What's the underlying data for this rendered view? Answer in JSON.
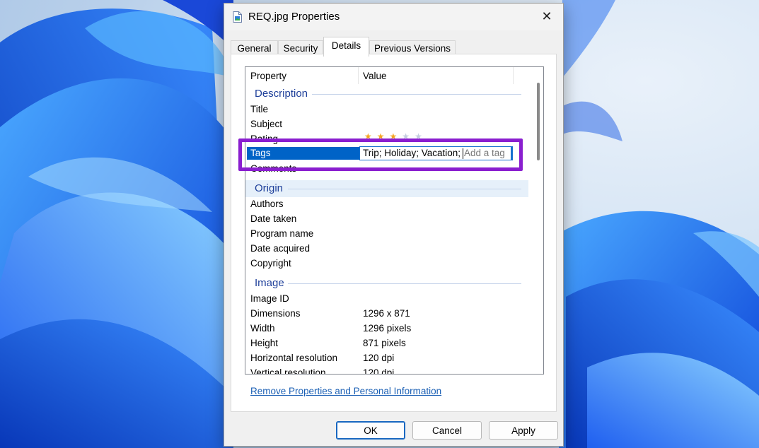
{
  "window": {
    "title": "REQ.jpg Properties",
    "close_glyph": "✕"
  },
  "tabs": [
    {
      "label": "General",
      "active": false
    },
    {
      "label": "Security",
      "active": false
    },
    {
      "label": "Details",
      "active": true
    },
    {
      "label": "Previous Versions",
      "active": false
    }
  ],
  "columns": {
    "property": "Property",
    "value": "Value"
  },
  "groups": {
    "description": "Description",
    "origin": "Origin",
    "image": "Image"
  },
  "description_rows": {
    "title": "Title",
    "subject": "Subject",
    "rating": "Rating",
    "tags": "Tags",
    "comments": "Comments"
  },
  "rating": {
    "stars_filled": 3,
    "stars_total": 5,
    "filled_color": "#f5a623",
    "empty_color": "#c5cce0"
  },
  "tags_value": "Trip; Holiday; Vacation;",
  "tags_placeholder": "Add a tag",
  "origin_rows": {
    "authors": "Authors",
    "date_taken": "Date taken",
    "program_name": "Program name",
    "date_acquired": "Date acquired",
    "copyright": "Copyright"
  },
  "image_rows": {
    "image_id": {
      "label": "Image ID",
      "value": ""
    },
    "dimensions": {
      "label": "Dimensions",
      "value": "1296 x 871"
    },
    "width": {
      "label": "Width",
      "value": "1296 pixels"
    },
    "height": {
      "label": "Height",
      "value": "871 pixels"
    },
    "horizontal_resolution": {
      "label": "Horizontal resolution",
      "value": "120 dpi"
    },
    "vertical_resolution": {
      "label": "Vertical resolution",
      "value": "120 dpi"
    }
  },
  "link": "Remove Properties and Personal Information",
  "buttons": {
    "ok": "OK",
    "cancel": "Cancel",
    "apply": "Apply"
  },
  "colors": {
    "highlight": "#8a1ecf",
    "selection": "#0063c7",
    "group_text": "#1e3f9a",
    "link": "#1a5fb4"
  }
}
